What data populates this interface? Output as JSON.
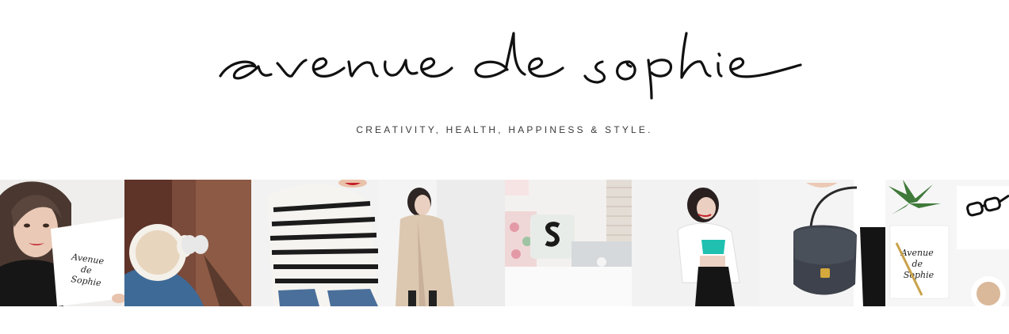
{
  "site": {
    "logo_text": "avenue de sophie",
    "tagline": "CREATIVITY, HEALTH, HAPPINESS & STYLE."
  },
  "gallery": {
    "tiles": [
      {
        "subject": "selfie-with-notebook",
        "note_text": [
          "Avenue",
          "de",
          "Sophie"
        ]
      },
      {
        "subject": "coffee-cup-on-floor"
      },
      {
        "subject": "striped-tshirt"
      },
      {
        "subject": "beige-coat-outfit"
      },
      {
        "subject": "bedroom-laptop"
      },
      {
        "subject": "white-blazer-outfit"
      },
      {
        "subject": "leather-bag"
      },
      {
        "subject": "desk-flatlay",
        "note_text": [
          "Avenue",
          "de",
          "Sophie"
        ]
      }
    ]
  },
  "colors": {
    "background": "#ffffff",
    "tagline": "#3a3a3a",
    "logo": "#111111"
  }
}
